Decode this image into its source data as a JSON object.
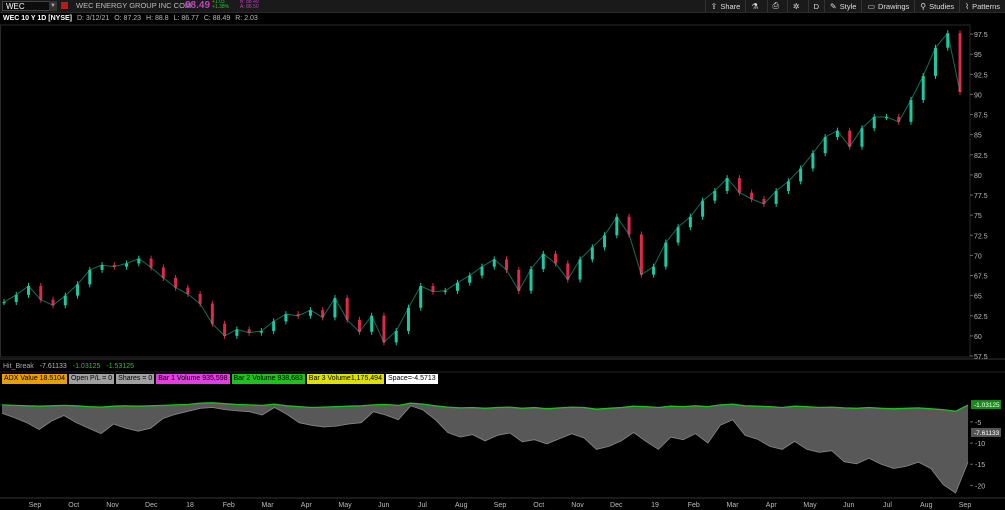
{
  "toolbar": {
    "symbol": "WEC",
    "company": "WEC ENERGY GROUP INC COM",
    "price": "88.49",
    "change": "+1.03",
    "change_pct": "+1.38%",
    "bid": "B: 88.49",
    "ask": "A: 88.50",
    "items": [
      {
        "label": "Share",
        "icon": "share-icon"
      },
      {
        "label": "",
        "icon": "flask-icon"
      },
      {
        "label": "",
        "icon": "print-icon"
      },
      {
        "label": "",
        "icon": "gear-icon"
      },
      {
        "label": "D",
        "icon": ""
      },
      {
        "label": "Style",
        "icon": "style-icon"
      },
      {
        "label": "Drawings",
        "icon": "drawings-icon"
      },
      {
        "label": "Studies",
        "icon": "studies-icon"
      },
      {
        "label": "Patterns",
        "icon": "patterns-icon"
      }
    ]
  },
  "info": {
    "symbol": "WEC 10 Y 1D [NYSE]",
    "date": "D: 3/12/21",
    "open": "O: 87.23",
    "high": "H: 88.8",
    "low": "L: 86.77",
    "close": "C: 88.49",
    "range": "R: 2.03"
  },
  "study": {
    "name": "Hit_Break",
    "values": [
      "-7.61133",
      "-1.03125",
      "-1.53125"
    ]
  },
  "badges": [
    {
      "text": "ADX Value 18.5104",
      "color": "#e8a000"
    },
    {
      "text": "Open P/L = 0",
      "color": "#a0a0a0"
    },
    {
      "text": "Shares = 0",
      "color": "#a0a0a0"
    },
    {
      "text": "Bar 1 Volume 935,598",
      "color": "#e040e0"
    },
    {
      "text": "Bar 2 Volume 938,683",
      "color": "#20c020"
    },
    {
      "text": "Bar 3 Volume1,175,494",
      "color": "#e0e000"
    },
    {
      "text": "Space=-4.5713",
      "color": "#ffffff"
    }
  ],
  "colors": {
    "up": "#1ec8a0",
    "down": "#e02848",
    "magenta": "#e040e0",
    "green_line": "#20c020"
  },
  "chart_data": [
    {
      "type": "line",
      "title": "WEC 10 Y 1D [NYSE]",
      "x_ticks": [
        "Sep",
        "Oct",
        "Nov",
        "Dec",
        "18",
        "Feb",
        "Mar",
        "Apr",
        "May",
        "Jun",
        "Jul",
        "Aug",
        "Sep",
        "Oct",
        "Nov",
        "Dec",
        "19",
        "Feb",
        "Mar",
        "Apr",
        "May",
        "Jun",
        "Jul",
        "Aug",
        "Sep"
      ],
      "y_ticks": [
        "97.5",
        "95",
        "92.5",
        "90",
        "87.5",
        "85",
        "82.5",
        "80",
        "77.5",
        "75",
        "72.5",
        "70",
        "67.5",
        "65",
        "62.5",
        "60",
        "57.5"
      ],
      "ylim": [
        57.5,
        98.5
      ],
      "close_points": [
        {
          "x": "Sep",
          "y": 64.2
        },
        {
          "x": "Sep",
          "y": 65.1
        },
        {
          "x": "Sep",
          "y": 66.2
        },
        {
          "x": "Oct",
          "y": 64.5
        },
        {
          "x": "Oct",
          "y": 63.8
        },
        {
          "x": "Oct",
          "y": 65.0
        },
        {
          "x": "Oct",
          "y": 66.4
        },
        {
          "x": "Nov",
          "y": 68.2
        },
        {
          "x": "Nov",
          "y": 68.8
        },
        {
          "x": "Nov",
          "y": 68.6
        },
        {
          "x": "Dec",
          "y": 69.0
        },
        {
          "x": "Dec",
          "y": 69.6
        },
        {
          "x": "Dec",
          "y": 68.5
        },
        {
          "x": "18",
          "y": 67.2
        },
        {
          "x": "18",
          "y": 66.0
        },
        {
          "x": "18",
          "y": 65.2
        },
        {
          "x": "18",
          "y": 64.0
        },
        {
          "x": "Feb",
          "y": 61.5
        },
        {
          "x": "Feb",
          "y": 60.0
        },
        {
          "x": "Feb",
          "y": 60.8
        },
        {
          "x": "Mar",
          "y": 60.4
        },
        {
          "x": "Mar",
          "y": 60.6
        },
        {
          "x": "Mar",
          "y": 61.8
        },
        {
          "x": "Apr",
          "y": 62.7
        },
        {
          "x": "Apr",
          "y": 62.5
        },
        {
          "x": "Apr",
          "y": 63.2
        },
        {
          "x": "May",
          "y": 62.3
        },
        {
          "x": "May",
          "y": 64.7
        },
        {
          "x": "May",
          "y": 62.0
        },
        {
          "x": "May",
          "y": 60.5
        },
        {
          "x": "Jun",
          "y": 62.5
        },
        {
          "x": "Jun",
          "y": 59.2
        },
        {
          "x": "Jun",
          "y": 60.6
        },
        {
          "x": "Jul",
          "y": 63.5
        },
        {
          "x": "Jul",
          "y": 66.2
        },
        {
          "x": "Jul",
          "y": 65.5
        },
        {
          "x": "Aug",
          "y": 65.6
        },
        {
          "x": "Aug",
          "y": 66.6
        },
        {
          "x": "Aug",
          "y": 67.5
        },
        {
          "x": "Sep",
          "y": 68.6
        },
        {
          "x": "Sep",
          "y": 69.5
        },
        {
          "x": "Sep",
          "y": 68.2
        },
        {
          "x": "Oct",
          "y": 65.6
        },
        {
          "x": "Oct",
          "y": 68.3
        },
        {
          "x": "Oct",
          "y": 70.2
        },
        {
          "x": "Nov",
          "y": 69.0
        },
        {
          "x": "Nov",
          "y": 67.0
        },
        {
          "x": "Nov",
          "y": 69.5
        },
        {
          "x": "Dec",
          "y": 71.0
        },
        {
          "x": "Dec",
          "y": 72.5
        },
        {
          "x": "Dec",
          "y": 74.8
        },
        {
          "x": "19",
          "y": 72.6
        },
        {
          "x": "19",
          "y": 67.6
        },
        {
          "x": "19",
          "y": 68.6
        },
        {
          "x": "Feb",
          "y": 71.6
        },
        {
          "x": "Feb",
          "y": 73.5
        },
        {
          "x": "Feb",
          "y": 74.8
        },
        {
          "x": "Mar",
          "y": 76.8
        },
        {
          "x": "Mar",
          "y": 78.0
        },
        {
          "x": "Mar",
          "y": 79.6
        },
        {
          "x": "Apr",
          "y": 77.8
        },
        {
          "x": "Apr",
          "y": 77.0
        },
        {
          "x": "Apr",
          "y": 76.4
        },
        {
          "x": "May",
          "y": 78.0
        },
        {
          "x": "May",
          "y": 79.2
        },
        {
          "x": "May",
          "y": 80.8
        },
        {
          "x": "Jun",
          "y": 82.7
        },
        {
          "x": "Jun",
          "y": 84.7
        },
        {
          "x": "Jun",
          "y": 85.5
        },
        {
          "x": "Jul",
          "y": 83.5
        },
        {
          "x": "Jul",
          "y": 85.8
        },
        {
          "x": "Jul",
          "y": 87.2
        },
        {
          "x": "Aug",
          "y": 87.2
        },
        {
          "x": "Aug",
          "y": 86.6
        },
        {
          "x": "Aug",
          "y": 89.3
        },
        {
          "x": "Aug",
          "y": 92.3
        },
        {
          "x": "Sep",
          "y": 95.8
        },
        {
          "x": "Sep",
          "y": 97.6
        },
        {
          "x": "Sep",
          "y": 90.3
        }
      ]
    },
    {
      "type": "area",
      "title": "Hit_Break",
      "y_ticks": [
        "-5",
        "-10",
        "-15",
        "-20"
      ],
      "ylim": [
        -22.5,
        3
      ],
      "value_labels": [
        "-1.03125",
        "-7.61133"
      ],
      "series": [
        {
          "name": "Hit_Break",
          "values": [
            -3,
            -4,
            -5.2,
            -6.8,
            -4.8,
            -3.5,
            -5.2,
            -6.5,
            -7.8,
            -5.5,
            -6.5,
            -7.2,
            -6.5,
            -4.2,
            -3.2,
            -2.5,
            -1.8,
            -1.6,
            -2.1,
            -2.4,
            -2.6,
            -3.4,
            -1.6,
            -3.2,
            -5.2,
            -5.8,
            -6.2,
            -6.0,
            -5.5,
            -5.2,
            -2.6,
            -3.4,
            -4.5,
            -1.2,
            -2.2,
            -4.5,
            -7.5,
            -8.6,
            -8.0,
            -9.5,
            -8.2,
            -7.6,
            -9.7,
            -9.2,
            -10.2,
            -9.0,
            -7.8,
            -8.8,
            -11.5,
            -10.8,
            -9.5,
            -7.5,
            -9.6,
            -11.5,
            -8.6,
            -9.2,
            -7.8,
            -10.0,
            -5.8,
            -4.5,
            -8.2,
            -9.1,
            -10.8,
            -11.5,
            -9.6,
            -11.5,
            -12.2,
            -11.8,
            -14.4,
            -14.9,
            -13.6,
            -15.0,
            -16.0,
            -15.5,
            -14.5,
            -16.0,
            -19.8,
            -21.8,
            -14.5
          ]
        },
        {
          "name": "Bar 2 Volume",
          "values": [
            -1.0,
            -1.1,
            -1.2,
            -1.3,
            -1.2,
            -1.1,
            -1.2,
            -1.4,
            -1.5,
            -1.3,
            -1.2,
            -1.3,
            -1.2,
            -1.1,
            -1.0,
            -0.9,
            -0.6,
            -0.5,
            -0.7,
            -0.9,
            -1.0,
            -1.1,
            -0.8,
            -1.2,
            -1.4,
            -1.6,
            -1.5,
            -1.4,
            -1.3,
            -1.2,
            -1.0,
            -0.9,
            -1.1,
            -0.6,
            -0.8,
            -1.2,
            -1.5,
            -1.7,
            -1.6,
            -1.8,
            -1.6,
            -1.5,
            -1.8,
            -1.6,
            -1.9,
            -1.7,
            -1.5,
            -1.6,
            -2.0,
            -1.8,
            -1.6,
            -1.3,
            -1.4,
            -1.6,
            -1.3,
            -1.4,
            -1.2,
            -1.4,
            -1.0,
            -0.8,
            -1.2,
            -1.3,
            -1.4,
            -1.6,
            -1.3,
            -1.4,
            -1.6,
            -1.5,
            -1.7,
            -1.8,
            -1.6,
            -1.8,
            -1.9,
            -1.8,
            -1.7,
            -1.9,
            -2.1,
            -2.5,
            -1.03
          ]
        }
      ]
    }
  ]
}
